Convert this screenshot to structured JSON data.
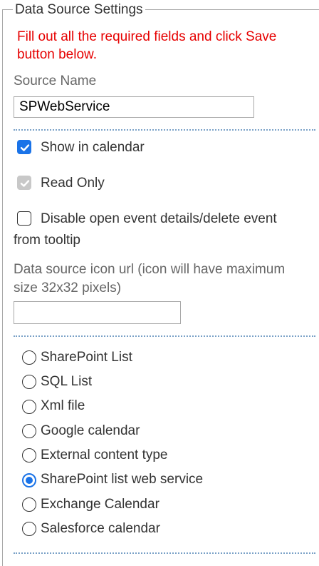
{
  "legend": "Data Source Settings",
  "notice": "Fill out all the required fields and click Save button below.",
  "source_name": {
    "label": "Source Name",
    "value": "SPWebService"
  },
  "checkboxes": [
    {
      "label": "Show in calendar",
      "checked": true,
      "disabled": false
    },
    {
      "label": "Read Only",
      "checked": true,
      "disabled": true
    },
    {
      "label": "Disable open event details/delete event",
      "label_continued": "from tooltip",
      "checked": false,
      "disabled": false
    }
  ],
  "icon_url": {
    "label": "Data source icon url (icon will have maximum",
    "label_continued": "size 32x32 pixels)",
    "value": ""
  },
  "source_types": {
    "selected": "SharePoint list web service",
    "options": [
      "SharePoint List",
      "SQL List",
      "Xml file",
      "Google calendar",
      "External content type",
      "SharePoint list web service",
      "Exchange Calendar",
      "Salesforce calendar"
    ]
  },
  "colors": {
    "notice": "#e60000",
    "accent": "#1a73e8",
    "separator": "#7aa1c7",
    "border": "#a8a8a8"
  }
}
